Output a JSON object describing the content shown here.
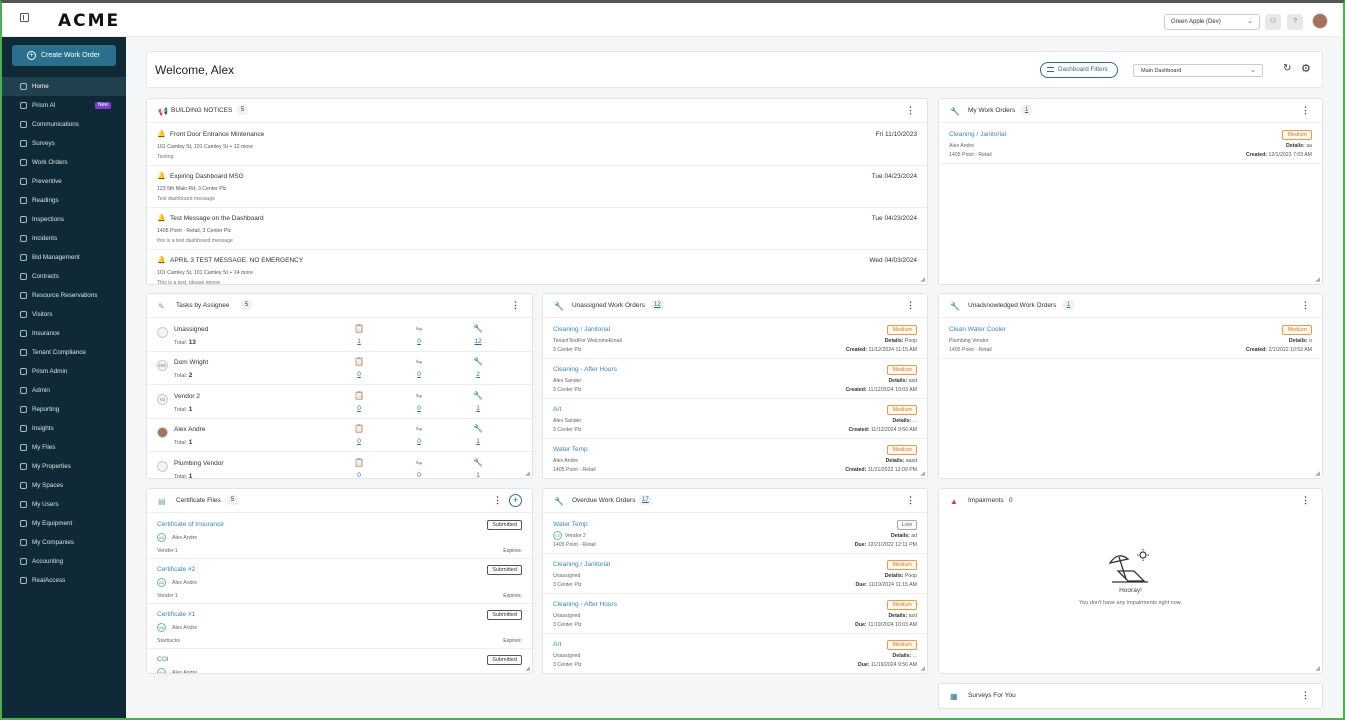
{
  "app": {
    "logo": "ACME",
    "org": "Green Apple (Dev)"
  },
  "sidebar": {
    "create_label": "Create Work Order",
    "items": [
      {
        "label": "Home",
        "active": true
      },
      {
        "label": "Prism AI",
        "badge": "New"
      },
      {
        "label": "Communications"
      },
      {
        "label": "Surveys"
      },
      {
        "label": "Work Orders"
      },
      {
        "label": "Preventive"
      },
      {
        "label": "Readings"
      },
      {
        "label": "Inspections"
      },
      {
        "label": "Incidents"
      },
      {
        "label": "Bid Management"
      },
      {
        "label": "Contracts"
      },
      {
        "label": "Resource Reservations"
      },
      {
        "label": "Visitors"
      },
      {
        "label": "Insurance"
      },
      {
        "label": "Tenant Compliance"
      },
      {
        "label": "Prism Admin"
      },
      {
        "label": "Admin"
      },
      {
        "label": "Reporting"
      },
      {
        "label": "Insights"
      },
      {
        "label": "My Files"
      },
      {
        "label": "My Properties"
      },
      {
        "label": "My Spaces"
      },
      {
        "label": "My Users"
      },
      {
        "label": "My Equipment"
      },
      {
        "label": "My Companies"
      },
      {
        "label": "Accounting"
      },
      {
        "label": "RealAccess"
      }
    ]
  },
  "header": {
    "welcome": "Welcome, Alex",
    "filters_label": "Dashboard Filters",
    "dashboard_select": "Main Dashboard"
  },
  "notices": {
    "title": "BUILDING NOTICES",
    "count": "5",
    "items": [
      {
        "title": "Front Door Entrance Mintenance",
        "date": "Fri 11/10/2023",
        "location": "101 Camley St, 101 Camley St + 12 more",
        "desc": "Testing"
      },
      {
        "title": "Expiring Dashboard MSG",
        "date": "Tue 04/23/2024",
        "location": "123 5th Main Rd, 3 Center Plz",
        "desc": "Test dashboard message"
      },
      {
        "title": "Test Message on the Dashboard",
        "date": "Tue 04/23/2024",
        "location": "1405 Point - Retail, 3 Center Plz",
        "desc": "this is a test dashboard message"
      },
      {
        "title": "APRIL 3 TEST MESSAGE. NO EMERGENCY",
        "date": "Wed 04/03/2024",
        "location": "101 Camley St, 101 Camley St + 14 more",
        "desc": "This is a test, please ignore"
      }
    ]
  },
  "my_work_orders": {
    "title": "My Work Orders",
    "count": "1",
    "items": [
      {
        "title": "Cleaning / Janitorial",
        "priority": "Medium",
        "user": "Alex Andre",
        "location": "1405 Point - Retail",
        "details_label": "Details:",
        "details": "aa",
        "created_label": "Created:",
        "created": "12/1/2023 7:03 AM"
      }
    ]
  },
  "tasks": {
    "title": "Tasks by Assignee",
    "count": "5",
    "total_label": "Total:",
    "items": [
      {
        "name": "Unassigned",
        "initials": "",
        "total": "13",
        "c1": "1",
        "c2": "0",
        "c3": "12"
      },
      {
        "name": "Dom Wright",
        "initials": "DW",
        "total": "2",
        "c1": "0",
        "c2": "0",
        "c3": "2"
      },
      {
        "name": "Vendor 2",
        "initials": "V2",
        "total": "1",
        "c1": "0",
        "c2": "0",
        "c3": "1"
      },
      {
        "name": "Alex Andre",
        "initials": "",
        "total": "1",
        "c1": "0",
        "c2": "0",
        "c3": "1"
      },
      {
        "name": "Plumbing Vendor",
        "initials": "",
        "total": "1",
        "c1": "0",
        "c2": "0",
        "c3": "1"
      }
    ]
  },
  "unassigned": {
    "title": "Unassigned Work Orders",
    "count": "12",
    "items": [
      {
        "title": "Cleaning / Janitorial",
        "priority": "Medium",
        "user": "TenantTestFor WelcomeEmail",
        "location": "3 Center Plz",
        "details": "Poop",
        "created": "11/12/2024 11:15 AM"
      },
      {
        "title": "Cleaning - After Hours",
        "priority": "Medium",
        "user": "Alex Sander",
        "location": "3 Center Plz",
        "details": "asd",
        "created": "11/12/2024 10:03 AM"
      },
      {
        "title": "Art",
        "priority": "Medium",
        "user": "Alex Sander",
        "location": "3 Center Plz",
        "details": "...",
        "created": "11/12/2024 9:56 AM"
      },
      {
        "title": "Water Temp",
        "priority": "Medium",
        "user": "Alex Andre",
        "location": "1405 Point - Retail",
        "details": "aasd",
        "created": "11/21/2022 12:09 PM"
      }
    ]
  },
  "unack": {
    "title": "Unacknowledged Work Orders",
    "count": "1",
    "items": [
      {
        "title": "Clean Water Cooler",
        "priority": "Medium",
        "user": "Plumbing Vendor",
        "location": "1405 Point - Retail",
        "details": "o",
        "created": "2/1/2022 10:53 AM"
      }
    ]
  },
  "certs": {
    "title": "Certificate Files",
    "count": "5",
    "expires_label": "Expires:",
    "items": [
      {
        "title": "Certificate of Insurance",
        "status": "Submitted",
        "user": "Alex Andre",
        "vendor": "Vendor 1"
      },
      {
        "title": "Certificate #2",
        "status": "Submitted",
        "user": "Alex Andre",
        "vendor": "Vendor 1"
      },
      {
        "title": "Certificate #1",
        "status": "Submitted",
        "user": "Alex Andre",
        "vendor": "Starbucks"
      },
      {
        "title": "COI",
        "status": "Submitted",
        "user": "Alex Andre",
        "vendor": ""
      }
    ]
  },
  "overdue": {
    "title": "Overdue Work Orders",
    "count": "17",
    "due_label": "Due:",
    "items": [
      {
        "title": "Water Temp",
        "priority": "Low",
        "user": "Vendor 2",
        "initials": "V2",
        "location": "1405 Point - Retail",
        "details": "ad",
        "due": "12/21/2022 12:11 PM"
      },
      {
        "title": "Cleaning / Janitorial",
        "priority": "Medium",
        "user": "Unassigned",
        "initials": "",
        "location": "3 Center Plz",
        "details": "Poop",
        "due": "11/19/2024 11:15 AM"
      },
      {
        "title": "Cleaning - After Hours",
        "priority": "Medium",
        "user": "Unassigned",
        "initials": "",
        "location": "3 Center Plz",
        "details": "asd",
        "due": "11/19/2024 10:03 AM"
      },
      {
        "title": "Art",
        "priority": "Medium",
        "user": "Unassigned",
        "initials": "",
        "location": "3 Center Plz",
        "details": "...",
        "due": "11/19/2024 9:56 AM"
      }
    ]
  },
  "impairments": {
    "title": "Impairments",
    "count": "0",
    "empty_title": "Hooray!",
    "empty_sub": "You don't have any impairments right now."
  },
  "surveys": {
    "title": "Surveys For You"
  },
  "colors": {
    "sidebar": "#0f2a36",
    "accent": "#2b6f8e",
    "link": "#3a86b8",
    "medium": "#e07a1f"
  }
}
